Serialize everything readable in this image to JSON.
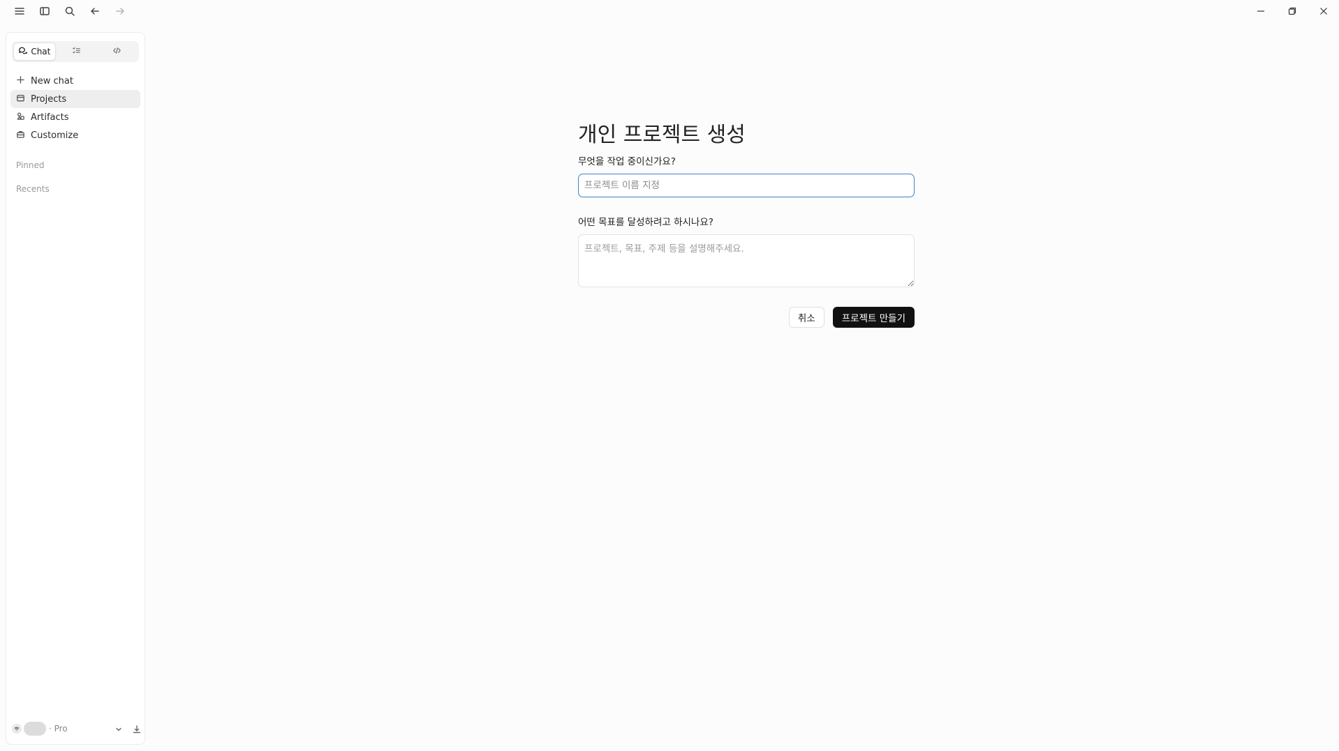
{
  "titlebar": {
    "icons": [
      "menu-icon",
      "sidebar-toggle-icon",
      "search-icon",
      "back-arrow-icon",
      "forward-arrow-icon"
    ],
    "window_controls": [
      "minimize-icon",
      "restore-icon",
      "close-icon"
    ]
  },
  "sidebar": {
    "tabs": [
      {
        "label": "Chat",
        "icon": "chat-bubbles-icon",
        "active": true
      },
      {
        "label": "",
        "icon": "list-icon",
        "active": false
      },
      {
        "label": "",
        "icon": "code-icon",
        "active": false
      }
    ],
    "nav": [
      {
        "label": "New chat",
        "icon": "plus-icon"
      },
      {
        "label": "Projects",
        "icon": "folder-icon",
        "active": true
      },
      {
        "label": "Artifacts",
        "icon": "artifacts-icon"
      },
      {
        "label": "Customize",
        "icon": "briefcase-icon"
      }
    ],
    "pinned_label": "Pinned",
    "recents_label": "Recents",
    "footer": {
      "plan": "· Pro"
    }
  },
  "form": {
    "title": "개인 프로젝트 생성",
    "name_label": "무엇을 작업 중이신가요?",
    "name_placeholder": "프로젝트 이름 지정",
    "goal_label": "어떤 목표를 달성하려고 하시나요?",
    "goal_placeholder": "프로젝트, 목표, 주제 등을 설명해주세요.",
    "cancel_label": "취소",
    "create_label": "프로젝트 만들기"
  },
  "colors": {
    "accent_focus": "#3b82c4",
    "primary_button": "#111111",
    "background": "#fcfcfc"
  }
}
